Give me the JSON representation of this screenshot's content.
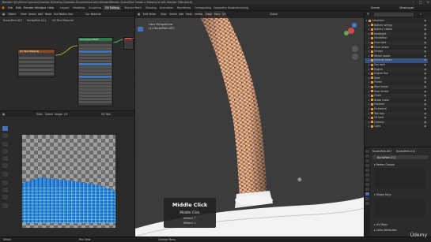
{
  "window": {
    "title": "Blender* [D:\\Online Courses\\Creative 3D\\Harley-Davidson-Knucklehead with Blender\\Blender Scene\\Part Create a Motorcycle with Blender 3\\Nil.blend]"
  },
  "menubar": {
    "items": [
      "File",
      "Edit",
      "Render",
      "Window",
      "Help"
    ],
    "workspaces": [
      "Layout",
      "Modeling",
      "Sculpting",
      "UV Editing",
      "Texture Paint",
      "Shading",
      "Animation",
      "Rendering",
      "Compositing",
      "Geometry Nodes",
      "Scripting"
    ],
    "active_workspace": "UV Editing",
    "scene": "Scene",
    "view_layer": "ViewLayer"
  },
  "node_editor": {
    "header": [
      "Object",
      "View",
      "Select",
      "Add",
      "Node",
      "Use Nodes",
      "Slot",
      "Cur Material"
    ],
    "breadcrumb": [
      "NurbsPath.007",
      "NurbsPath.011",
      "UV Test Material"
    ],
    "texture_node_title": "UV Test Material",
    "bsdf_node_title": "Principled BSDF",
    "output_node_title": "Material Output"
  },
  "image_editor": {
    "header": [
      "View",
      "Select",
      "Image",
      "UV"
    ],
    "image_name": "UV Test"
  },
  "viewport": {
    "header": [
      "Edit Mode",
      "View",
      "Select",
      "Add",
      "Mesh",
      "Vertex",
      "Edge",
      "Face",
      "UV"
    ],
    "transform": "Global",
    "info_line1": "User Perspective",
    "info_line2": "(1) NurbsPath.007"
  },
  "key_popup": {
    "title": "Middle Click",
    "subtitle": "Middle Click",
    "line3": "Wheel ↑",
    "line4": "Wheel ↓"
  },
  "outliner": {
    "rows": [
      {
        "label": "Collection",
        "selected": false
      },
      {
        "label": "Battery wiring",
        "selected": false
      },
      {
        "label": "Battery cables",
        "selected": false
      },
      {
        "label": "Headlight",
        "selected": false
      },
      {
        "label": "Handlebar",
        "selected": false
      },
      {
        "label": "Front fork",
        "selected": false
      },
      {
        "label": "Front wheel",
        "selected": false
      },
      {
        "label": "Fender",
        "selected": false
      },
      {
        "label": "Wheel spoke",
        "selected": false
      },
      {
        "label": "Exhaust pipes",
        "selected": true
      },
      {
        "label": "Gas tank",
        "selected": false
      },
      {
        "label": "Engine",
        "selected": false
      },
      {
        "label": "Engine fins",
        "selected": false
      },
      {
        "label": "Seat",
        "selected": false
      },
      {
        "label": "Frame",
        "selected": false
      },
      {
        "label": "Rear wheel",
        "selected": false
      },
      {
        "label": "Rear fender",
        "selected": false
      },
      {
        "label": "Chain",
        "selected": false
      },
      {
        "label": "Brake cable",
        "selected": false
      },
      {
        "label": "Footrest",
        "selected": false
      },
      {
        "label": "Kickstand",
        "selected": false
      },
      {
        "label": "Tool box",
        "selected": false
      },
      {
        "label": "Oil tank",
        "selected": false
      },
      {
        "label": "Camera",
        "selected": false
      },
      {
        "label": "Light",
        "selected": false
      }
    ]
  },
  "properties": {
    "breadcrumb": [
      "NurbsPath.007",
      "NurbsPath.011"
    ],
    "object_name": "NurbsPath.011",
    "panels": [
      "Vertex Groups",
      "Shape Keys",
      "UV Maps",
      "Color Attributes"
    ]
  },
  "statusbar": {
    "left": "Select",
    "middle": "Pan View",
    "right": "Context Menu"
  },
  "watermark": "Údemy",
  "colors": {
    "selection_blue": "#4673b8",
    "outliner_icon": "#e69b3a",
    "uv_mesh": "#2b7fd6",
    "pipe_copper": "#b86a45"
  }
}
